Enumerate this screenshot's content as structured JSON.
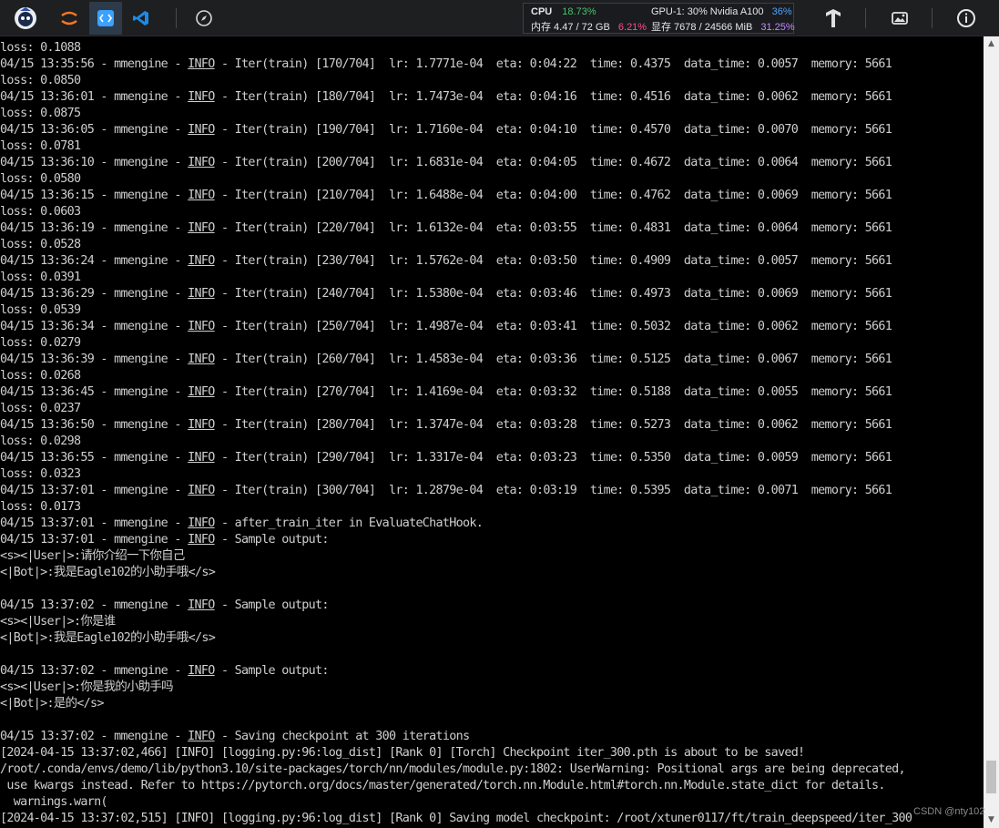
{
  "toolbar": {
    "apps": [
      "app-logo",
      "jupyter-icon",
      "code-editor-icon",
      "vscode-icon",
      "compass-icon"
    ],
    "right_icons": [
      "tensorboard-icon",
      "image-icon",
      "info-icon"
    ]
  },
  "monitor": {
    "cpu_label": "CPU",
    "cpu_value": "18.73%",
    "mem_label": "内存 4.47 / 72 GB",
    "mem_value": "6.21%",
    "gpu_label": "GPU-1: 30% Nvidia A100",
    "gpu_value": "36%",
    "vram_label": "显存 7678 / 24566 MiB",
    "vram_value": "31.25%"
  },
  "terminal": {
    "lines": [
      "loss: 0.1088",
      "04/15 13:35:56 - mmengine - INFO - Iter(train) [170/704]  lr: 1.7771e-04  eta: 0:04:22  time: 0.4375  data_time: 0.0057  memory: 5661",
      "loss: 0.0850",
      "04/15 13:36:01 - mmengine - INFO - Iter(train) [180/704]  lr: 1.7473e-04  eta: 0:04:16  time: 0.4516  data_time: 0.0062  memory: 5661",
      "loss: 0.0875",
      "04/15 13:36:05 - mmengine - INFO - Iter(train) [190/704]  lr: 1.7160e-04  eta: 0:04:10  time: 0.4570  data_time: 0.0070  memory: 5661",
      "loss: 0.0781",
      "04/15 13:36:10 - mmengine - INFO - Iter(train) [200/704]  lr: 1.6831e-04  eta: 0:04:05  time: 0.4672  data_time: 0.0064  memory: 5661",
      "loss: 0.0580",
      "04/15 13:36:15 - mmengine - INFO - Iter(train) [210/704]  lr: 1.6488e-04  eta: 0:04:00  time: 0.4762  data_time: 0.0069  memory: 5661",
      "loss: 0.0603",
      "04/15 13:36:19 - mmengine - INFO - Iter(train) [220/704]  lr: 1.6132e-04  eta: 0:03:55  time: 0.4831  data_time: 0.0064  memory: 5661",
      "loss: 0.0528",
      "04/15 13:36:24 - mmengine - INFO - Iter(train) [230/704]  lr: 1.5762e-04  eta: 0:03:50  time: 0.4909  data_time: 0.0057  memory: 5661",
      "loss: 0.0391",
      "04/15 13:36:29 - mmengine - INFO - Iter(train) [240/704]  lr: 1.5380e-04  eta: 0:03:46  time: 0.4973  data_time: 0.0069  memory: 5661",
      "loss: 0.0539",
      "04/15 13:36:34 - mmengine - INFO - Iter(train) [250/704]  lr: 1.4987e-04  eta: 0:03:41  time: 0.5032  data_time: 0.0062  memory: 5661",
      "loss: 0.0279",
      "04/15 13:36:39 - mmengine - INFO - Iter(train) [260/704]  lr: 1.4583e-04  eta: 0:03:36  time: 0.5125  data_time: 0.0067  memory: 5661",
      "loss: 0.0268",
      "04/15 13:36:45 - mmengine - INFO - Iter(train) [270/704]  lr: 1.4169e-04  eta: 0:03:32  time: 0.5188  data_time: 0.0055  memory: 5661",
      "loss: 0.0237",
      "04/15 13:36:50 - mmengine - INFO - Iter(train) [280/704]  lr: 1.3747e-04  eta: 0:03:28  time: 0.5273  data_time: 0.0062  memory: 5661",
      "loss: 0.0298",
      "04/15 13:36:55 - mmengine - INFO - Iter(train) [290/704]  lr: 1.3317e-04  eta: 0:03:23  time: 0.5350  data_time: 0.0059  memory: 5661",
      "loss: 0.0323",
      "04/15 13:37:01 - mmengine - INFO - Iter(train) [300/704]  lr: 1.2879e-04  eta: 0:03:19  time: 0.5395  data_time: 0.0071  memory: 5661",
      "loss: 0.0173",
      "04/15 13:37:01 - mmengine - INFO - after_train_iter in EvaluateChatHook.",
      "04/15 13:37:01 - mmengine - INFO - Sample output:",
      "<s><|User|>:请你介绍一下你自己",
      "<|Bot|>:我是Eagle102的小助手哦</s>",
      "",
      "04/15 13:37:02 - mmengine - INFO - Sample output:",
      "<s><|User|>:你是谁",
      "<|Bot|>:我是Eagle102的小助手哦</s>",
      "",
      "04/15 13:37:02 - mmengine - INFO - Sample output:",
      "<s><|User|>:你是我的小助手吗",
      "<|Bot|>:是的</s>",
      "",
      "04/15 13:37:02 - mmengine - INFO - Saving checkpoint at 300 iterations",
      "[2024-04-15 13:37:02,466] [INFO] [logging.py:96:log_dist] [Rank 0] [Torch] Checkpoint iter_300.pth is about to be saved!",
      "/root/.conda/envs/demo/lib/python3.10/site-packages/torch/nn/modules/module.py:1802: UserWarning: Positional args are being deprecated,",
      " use kwargs instead. Refer to https://pytorch.org/docs/master/generated/torch.nn.Module.html#torch.nn.Module.state_dict for details.",
      "  warnings.warn(",
      "[2024-04-15 13:37:02,515] [INFO] [logging.py:96:log_dist] [Rank 0] Saving model checkpoint: /root/xtuner0117/ft/train_deepspeed/iter_300"
    ]
  },
  "scrollbar": {
    "up_icon": "scroll-up-arrow",
    "down_icon": "scroll-down-arrow"
  },
  "watermark": "CSDN @nty102"
}
